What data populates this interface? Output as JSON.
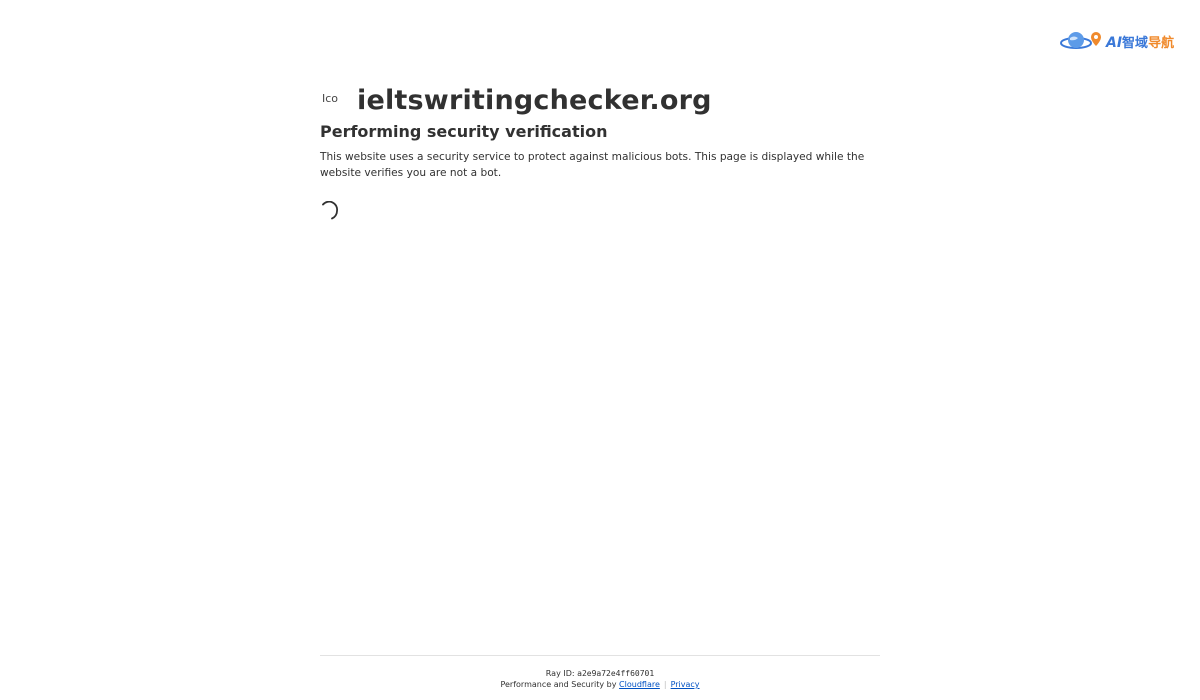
{
  "brand": {
    "logo_ai": "AI",
    "logo_cn_first": "智域",
    "logo_cn_second": "导航",
    "colors": {
      "blue": "#3a78d8",
      "orange": "#f08a2c"
    }
  },
  "site": {
    "favicon_alt": "Ico",
    "name": "ieltswritingchecker.org"
  },
  "verification": {
    "heading": "Performing security verification",
    "description": "This website uses a security service to protect against malicious bots. This page is displayed while the website verifies you are not a bot."
  },
  "footer": {
    "ray_label": "Ray ID:",
    "ray_id": "a2e9a72e4ff60701",
    "perf_text": "Performance and Security by",
    "cloudflare_link": "Cloudflare",
    "separator": "|",
    "privacy_link": "Privacy",
    "link_color": "#0051c3"
  }
}
